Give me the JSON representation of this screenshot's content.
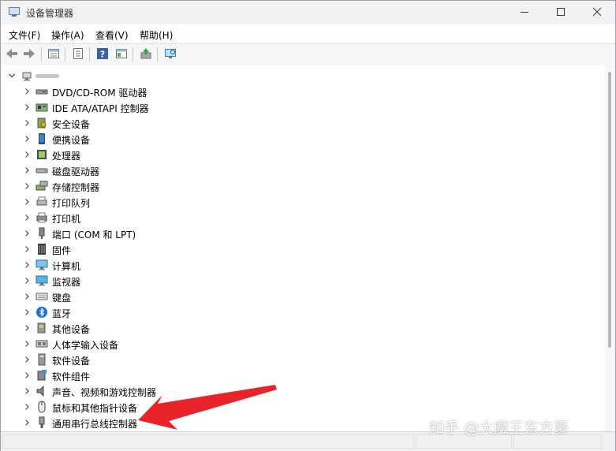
{
  "window": {
    "title": "设备管理器",
    "buttons": {
      "minimize": "minimize",
      "maximize": "maximize",
      "close": "close"
    }
  },
  "menubar": {
    "items": [
      {
        "label": "文件(F)"
      },
      {
        "label": "操作(A)"
      },
      {
        "label": "查看(V)"
      },
      {
        "label": "帮助(H)"
      }
    ]
  },
  "toolbar": {
    "buttons": [
      "back-icon",
      "forward-icon",
      "properties-icon",
      "list-icon",
      "help-icon",
      "console-icon",
      "update-driver-icon",
      "scan-hardware-icon"
    ]
  },
  "tree": {
    "root_icon": "computer-icon",
    "nodes": [
      {
        "label": "DVD/CD-ROM 驱动器",
        "icon": "dvd-drive-icon"
      },
      {
        "label": "IDE ATA/ATAPI 控制器",
        "icon": "ide-controller-icon"
      },
      {
        "label": "安全设备",
        "icon": "security-device-icon"
      },
      {
        "label": "便携设备",
        "icon": "portable-device-icon"
      },
      {
        "label": "处理器",
        "icon": "processor-icon"
      },
      {
        "label": "磁盘驱动器",
        "icon": "disk-drive-icon"
      },
      {
        "label": "存储控制器",
        "icon": "storage-controller-icon"
      },
      {
        "label": "打印队列",
        "icon": "print-queue-icon"
      },
      {
        "label": "打印机",
        "icon": "printer-icon"
      },
      {
        "label": "端口 (COM 和 LPT)",
        "icon": "port-icon"
      },
      {
        "label": "固件",
        "icon": "firmware-icon"
      },
      {
        "label": "计算机",
        "icon": "computer-icon"
      },
      {
        "label": "监视器",
        "icon": "monitor-icon"
      },
      {
        "label": "键盘",
        "icon": "keyboard-icon"
      },
      {
        "label": "蓝牙",
        "icon": "bluetooth-icon"
      },
      {
        "label": "其他设备",
        "icon": "other-devices-icon"
      },
      {
        "label": "人体学输入设备",
        "icon": "hid-icon"
      },
      {
        "label": "软件设备",
        "icon": "software-device-icon"
      },
      {
        "label": "软件组件",
        "icon": "software-component-icon"
      },
      {
        "label": "声音、视频和游戏控制器",
        "icon": "sound-icon"
      },
      {
        "label": "鼠标和其他指针设备",
        "icon": "mouse-icon"
      },
      {
        "label": "通用串行总线控制器",
        "icon": "usb-icon"
      }
    ]
  },
  "annotation": {
    "arrow_color": "#e8232a",
    "watermark": "知乎 @大魔王东方豪"
  },
  "colors": {
    "titlebar": "#f3f3f3",
    "toolbar": "#f6f6f6",
    "accent_blue": "#2b6fd6"
  }
}
